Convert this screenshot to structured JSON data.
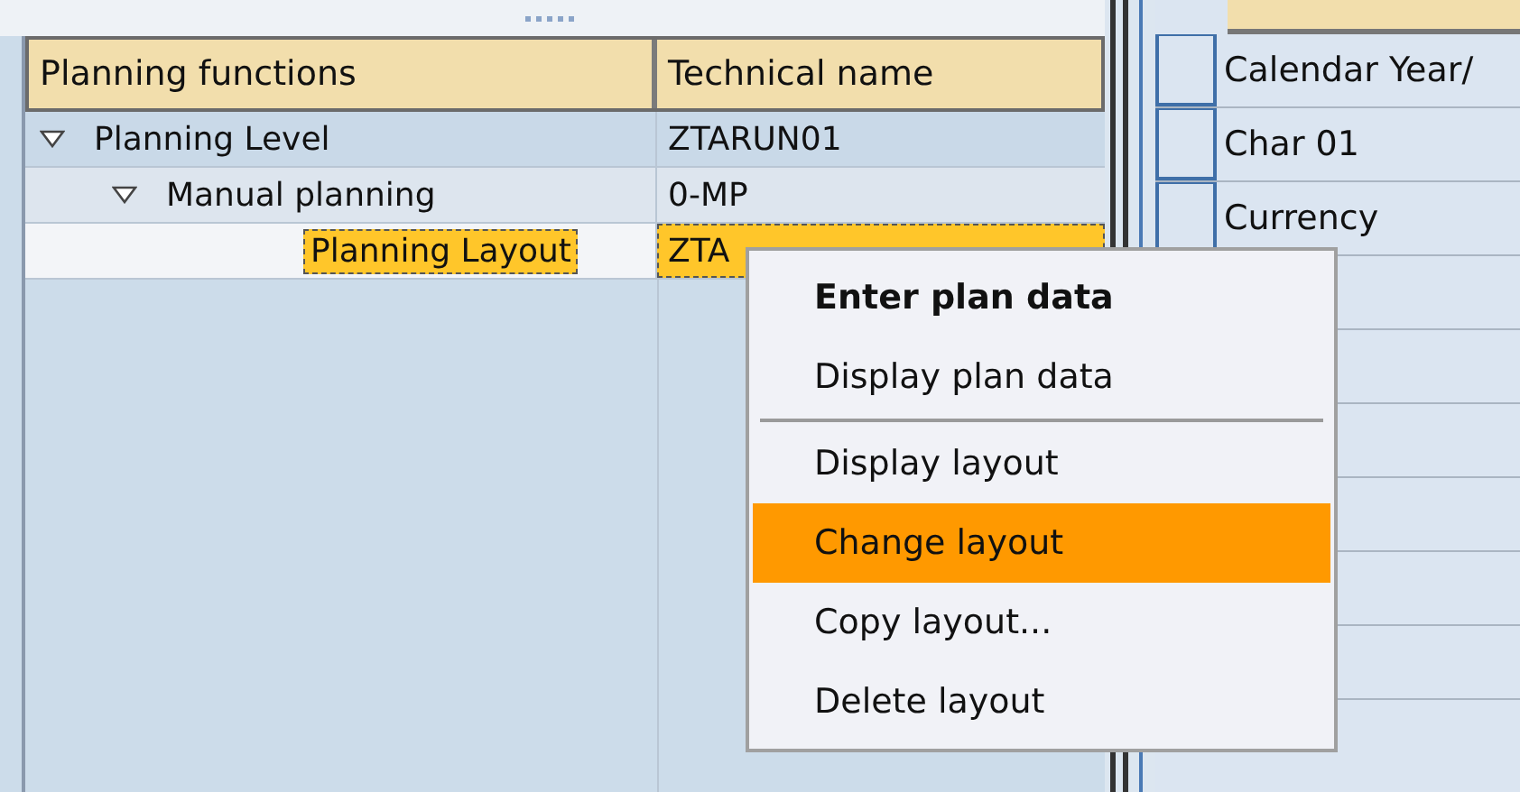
{
  "tree": {
    "columns": [
      "Planning functions",
      "Technical name"
    ],
    "rows": [
      {
        "label": "Planning Level",
        "technical_name": "ZTARUN01",
        "expanded": true,
        "selected": false,
        "children": [
          {
            "label": "Manual planning",
            "technical_name": "0-MP",
            "expanded": true,
            "selected": false,
            "children": [
              {
                "label": "Planning Layout",
                "technical_name": "ZTA",
                "selected": true
              }
            ]
          }
        ]
      }
    ]
  },
  "detail": {
    "rows": [
      "Calendar Year/",
      "Char 01",
      "Currency",
      "",
      "",
      "",
      "",
      "",
      ""
    ]
  },
  "context_menu": {
    "items": [
      {
        "kind": "item",
        "label": "Enter plan data",
        "default": true,
        "selected": false
      },
      {
        "kind": "item",
        "label": "Display plan data",
        "default": false,
        "selected": false
      },
      {
        "kind": "separator"
      },
      {
        "kind": "item",
        "label": "Display layout",
        "default": false,
        "selected": false
      },
      {
        "kind": "item",
        "label": "Change layout",
        "default": false,
        "selected": true
      },
      {
        "kind": "item",
        "label": "Copy layout...",
        "default": false,
        "selected": false
      },
      {
        "kind": "item",
        "label": "Delete layout",
        "default": false,
        "selected": false
      }
    ]
  }
}
